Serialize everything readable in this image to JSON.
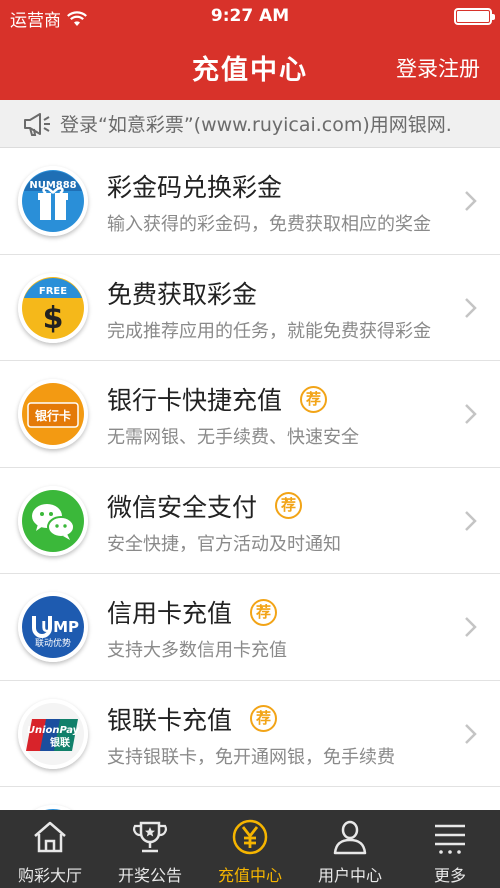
{
  "status": {
    "carrier": "运营商",
    "time": "9:27 AM"
  },
  "nav": {
    "title": "充值中心",
    "right_label": "登录注册"
  },
  "notice": {
    "text": "登录“如意彩票”(www.ruyicai.com)用网银网."
  },
  "icons": {
    "row_0_top": "NUM888",
    "row_1_top": "FREE",
    "row_1_center": "$",
    "row_2_center": "银行卡",
    "row_4_top": "UMP",
    "row_4_bottom": "联动优势",
    "row_5_top": "UnionPay",
    "row_5_bottom": "银联"
  },
  "badge_label": "荐",
  "items": [
    {
      "title": "彩金码兑换彩金",
      "subtitle": "输入获得的彩金码，免费获取相应的奖金"
    },
    {
      "title": "免费获取彩金",
      "subtitle": "完成推荐应用的任务，就能免费获得彩金"
    },
    {
      "title": "银行卡快捷充值",
      "subtitle": "无需网银、无手续费、快速安全"
    },
    {
      "title": "微信安全支付",
      "subtitle": "安全快捷，官方活动及时通知"
    },
    {
      "title": "信用卡充值",
      "subtitle": "支持大多数信用卡充值"
    },
    {
      "title": "银联卡充值",
      "subtitle": "支持银联卡，免开通网银，免手续费"
    }
  ],
  "tabs": [
    {
      "label": "购彩大厅"
    },
    {
      "label": "开奖公告"
    },
    {
      "label": "充值中心"
    },
    {
      "label": "用户中心"
    },
    {
      "label": "更多"
    }
  ],
  "colors": {
    "brand_red": "#d8322a",
    "accent_yellow": "#f6b500",
    "tabbar": "#333333"
  }
}
